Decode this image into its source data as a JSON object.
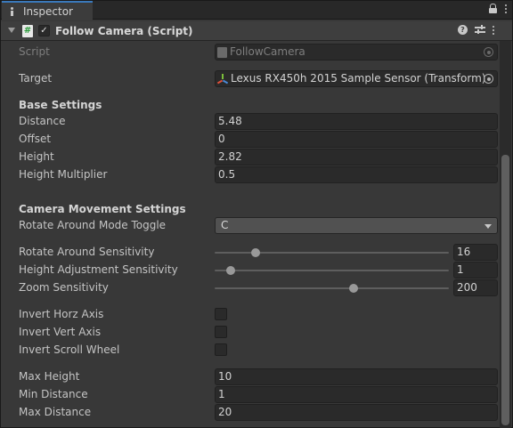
{
  "tab": {
    "label": "Inspector",
    "icon": "info-icon"
  },
  "component": {
    "title": "Follow Camera (Script)",
    "enabled": true,
    "script_icon_glyph": "#",
    "help_glyph": "?"
  },
  "fields": {
    "script": {
      "label": "Script",
      "value": "FollowCamera"
    },
    "target": {
      "label": "Target",
      "value": "Lexus RX450h 2015 Sample Sensor (Transform)"
    }
  },
  "base_settings": {
    "header": "Base Settings",
    "distance": {
      "label": "Distance",
      "value": "5.48"
    },
    "offset": {
      "label": "Offset",
      "value": "0"
    },
    "height": {
      "label": "Height",
      "value": "2.82"
    },
    "height_multiplier": {
      "label": "Height Multiplier",
      "value": "0.5"
    }
  },
  "camera_movement": {
    "header": "Camera Movement Settings",
    "rotate_mode": {
      "label": "Rotate Around Mode Toggle",
      "value": "C"
    },
    "rotate_sensitivity": {
      "label": "Rotate Around Sensitivity",
      "value": "16",
      "fraction": 0.175
    },
    "height_sensitivity": {
      "label": "Height Adjustment Sensitivity",
      "value": "1",
      "fraction": 0.07
    },
    "zoom_sensitivity": {
      "label": "Zoom Sensitivity",
      "value": "200",
      "fraction": 0.595
    }
  },
  "invert": {
    "horz": {
      "label": "Invert Horz Axis",
      "checked": false
    },
    "vert": {
      "label": "Invert Vert Axis",
      "checked": false
    },
    "scroll": {
      "label": "Invert Scroll Wheel",
      "checked": false
    }
  },
  "limits": {
    "max_height": {
      "label": "Max Height",
      "value": "10"
    },
    "min_distance": {
      "label": "Min Distance",
      "value": "1"
    },
    "max_distance": {
      "label": "Max Distance",
      "value": "20"
    }
  },
  "colors": {
    "accent": "#3a79bb",
    "panel": "#383838",
    "field": "#2a2a2a"
  }
}
